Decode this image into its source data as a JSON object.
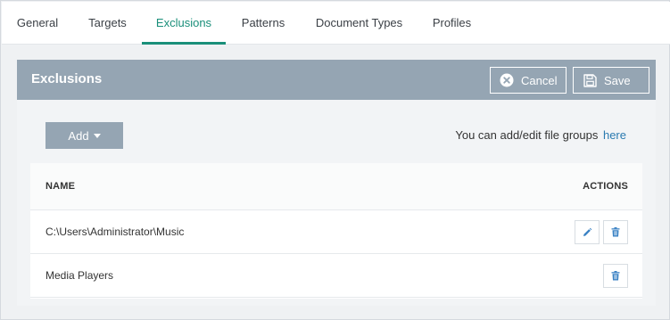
{
  "tabs": [
    {
      "label": "General",
      "active": false
    },
    {
      "label": "Targets",
      "active": false
    },
    {
      "label": "Exclusions",
      "active": true
    },
    {
      "label": "Patterns",
      "active": false
    },
    {
      "label": "Document Types",
      "active": false
    },
    {
      "label": "Profiles",
      "active": false
    }
  ],
  "panel": {
    "title": "Exclusions",
    "cancel_label": "Cancel",
    "cancel_icon": "close-circle-icon",
    "save_label": "Save",
    "save_icon": "floppy-disk-icon"
  },
  "toolbar": {
    "add_label": "Add",
    "hint_text": "You can add/edit file groups",
    "hint_link": "here"
  },
  "table": {
    "columns": [
      "NAME",
      "ACTIONS"
    ],
    "rows": [
      {
        "name": "C:\\Users\\Administrator\\Music",
        "actions": [
          "edit",
          "delete"
        ]
      },
      {
        "name": "Media Players",
        "actions": [
          "delete"
        ]
      }
    ]
  },
  "colors": {
    "accent": "#1a8f7a",
    "header_bg": "#95a5b3",
    "link": "#2a7ab0",
    "icon_blue": "#3a82c4"
  }
}
